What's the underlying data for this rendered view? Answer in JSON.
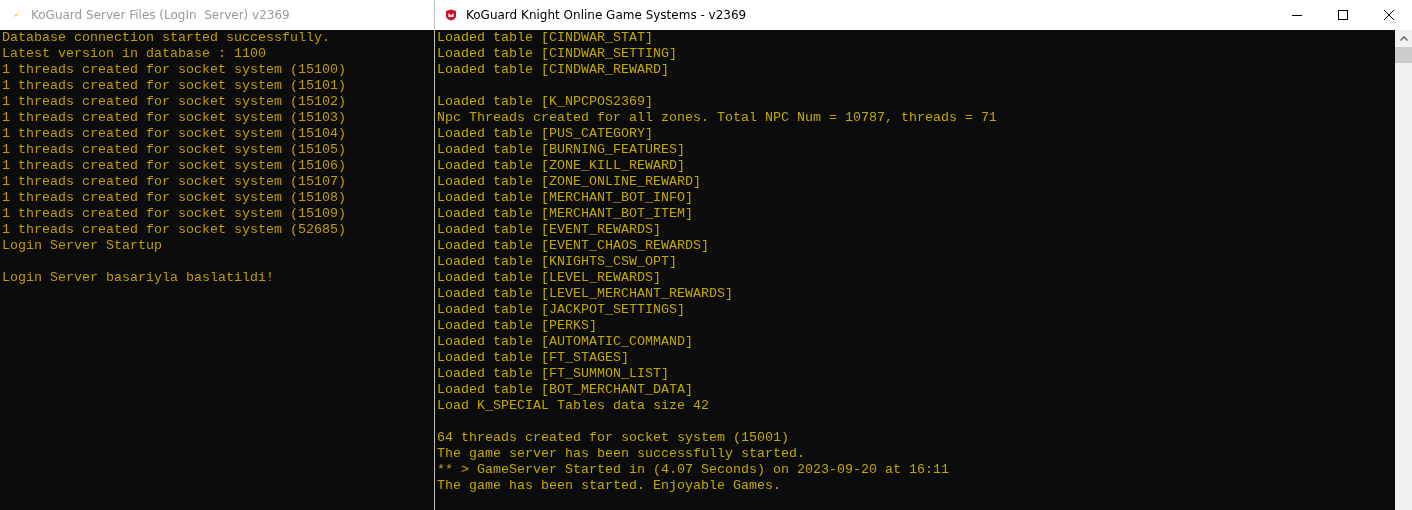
{
  "windows": [
    {
      "title": "KoGuard Server Files (LogIn  Server) v2369",
      "active": false,
      "lines": [
        {
          "kind": "text",
          "text": "Database connection started successfully."
        },
        {
          "kind": "text",
          "text": "Latest version in database : 1100"
        },
        {
          "kind": "text",
          "text": "1 threads created for socket system (15100)"
        },
        {
          "kind": "text",
          "text": "1 threads created for socket system (15101)"
        },
        {
          "kind": "text",
          "text": "1 threads created for socket system (15102)"
        },
        {
          "kind": "text",
          "text": "1 threads created for socket system (15103)"
        },
        {
          "kind": "text",
          "text": "1 threads created for socket system (15104)"
        },
        {
          "kind": "text",
          "text": "1 threads created for socket system (15105)"
        },
        {
          "kind": "text",
          "text": "1 threads created for socket system (15106)"
        },
        {
          "kind": "text",
          "text": "1 threads created for socket system (15107)"
        },
        {
          "kind": "text",
          "text": "1 threads created for socket system (15108)"
        },
        {
          "kind": "text",
          "text": "1 threads created for socket system (15109)"
        },
        {
          "kind": "text",
          "text": "1 threads created for socket system (52685)"
        },
        {
          "kind": "text",
          "text": "Login Server Startup"
        },
        {
          "kind": "blank"
        },
        {
          "kind": "text",
          "text": "Login Server basariyla baslatildi!"
        }
      ]
    },
    {
      "title": "KoGuard Knight Online Game Systems - v2369",
      "active": true,
      "lines": [
        {
          "kind": "text",
          "text": "Loaded table [CINDWAR_STAT]"
        },
        {
          "kind": "text",
          "text": "Loaded table [CINDWAR_SETTING]"
        },
        {
          "kind": "text",
          "text": "Loaded table [CINDWAR_REWARD]"
        },
        {
          "kind": "blank"
        },
        {
          "kind": "text",
          "text": "Loaded table [K_NPCPOS2369]"
        },
        {
          "kind": "text",
          "text": "Npc Threads created for all zones. Total NPC Num = 10787, threads = 71"
        },
        {
          "kind": "text",
          "text": "Loaded table [PUS_CATEGORY]"
        },
        {
          "kind": "text",
          "text": "Loaded table [BURNING_FEATURES]"
        },
        {
          "kind": "text",
          "text": "Loaded table [ZONE_KILL_REWARD]"
        },
        {
          "kind": "text",
          "text": "Loaded table [ZONE_ONLINE_REWARD]"
        },
        {
          "kind": "text",
          "text": "Loaded table [MERCHANT_BOT_INFO]"
        },
        {
          "kind": "text",
          "text": "Loaded table [MERCHANT_BOT_ITEM]"
        },
        {
          "kind": "text",
          "text": "Loaded table [EVENT_REWARDS]"
        },
        {
          "kind": "text",
          "text": "Loaded table [EVENT_CHAOS_REWARDS]"
        },
        {
          "kind": "text",
          "text": "Loaded table [KNIGHTS_CSW_OPT]"
        },
        {
          "kind": "text",
          "text": "Loaded table [LEVEL_REWARDS]"
        },
        {
          "kind": "text",
          "text": "Loaded table [LEVEL_MERCHANT_REWARDS]"
        },
        {
          "kind": "text",
          "text": "Loaded table [JACKPOT_SETTINGS]"
        },
        {
          "kind": "text",
          "text": "Loaded table [PERKS]"
        },
        {
          "kind": "text",
          "text": "Loaded table [AUTOMATIC_COMMAND]"
        },
        {
          "kind": "text",
          "text": "Loaded table [FT_STAGES]"
        },
        {
          "kind": "text",
          "text": "Loaded table [FT_SUMMON_LIST]"
        },
        {
          "kind": "text",
          "text": "Loaded table [BOT_MERCHANT_DATA]"
        },
        {
          "kind": "text",
          "text": "Load K_SPECIAL Tables data size 42"
        },
        {
          "kind": "blank"
        },
        {
          "kind": "text",
          "text": "64 threads created for socket system (15001)"
        },
        {
          "kind": "text",
          "text": "The game server has been successfully started."
        },
        {
          "kind": "text",
          "text": "** > GameServer Started in (4.07 Seconds) on 2023-09-20 at 16:11"
        },
        {
          "kind": "text",
          "text": "The game has been started. Enjoyable Games."
        }
      ]
    }
  ]
}
